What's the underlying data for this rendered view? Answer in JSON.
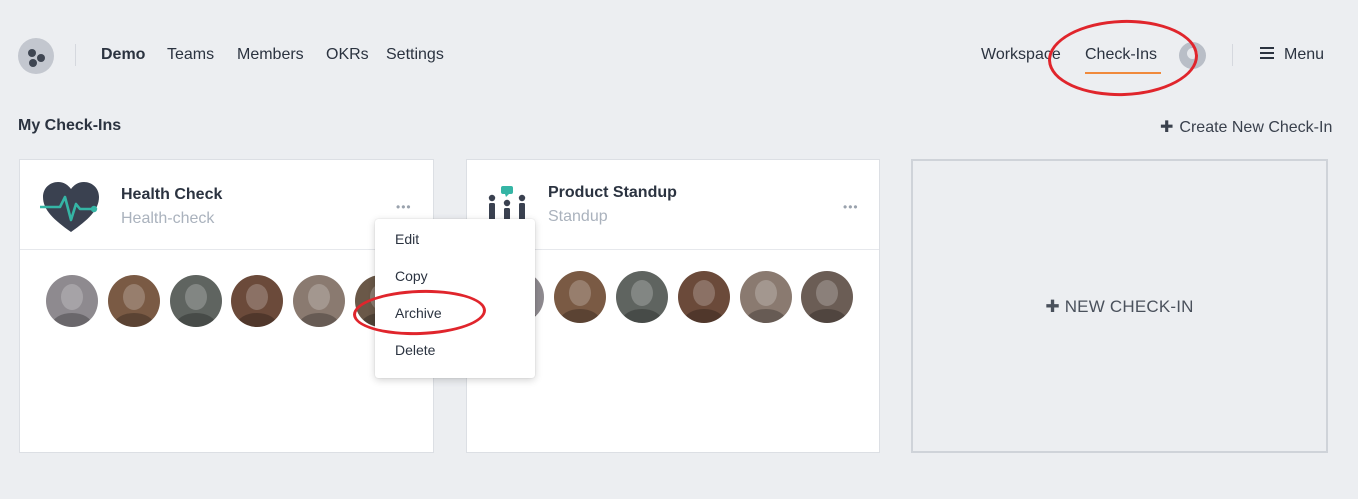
{
  "nav": {
    "brand": "Demo",
    "links": [
      "Teams",
      "Members",
      "OKRs",
      "Settings"
    ],
    "workspace": "Workspace",
    "checkins": "Check-Ins",
    "menu": "Menu"
  },
  "section": {
    "title": "My Check-Ins",
    "create": "Create New Check-In"
  },
  "cards": [
    {
      "title": "Health Check",
      "subtitle": "Health-check"
    },
    {
      "title": "Product Standup",
      "subtitle": "Standup"
    }
  ],
  "new_card": {
    "label": "NEW CHECK-IN"
  },
  "dropdown": {
    "items": [
      "Edit",
      "Copy",
      "Archive",
      "Delete"
    ]
  },
  "colors": {
    "accent": "#f08a3c",
    "annotation": "#e0252c",
    "teal": "#35b5a5",
    "icon_dark": "#3a4150"
  },
  "avatar_tones": [
    "#8e8a8f",
    "#7a5a44",
    "#5f6460",
    "#6b4a3a",
    "#8a7a70",
    "#6a5848",
    "#6b5d55"
  ]
}
